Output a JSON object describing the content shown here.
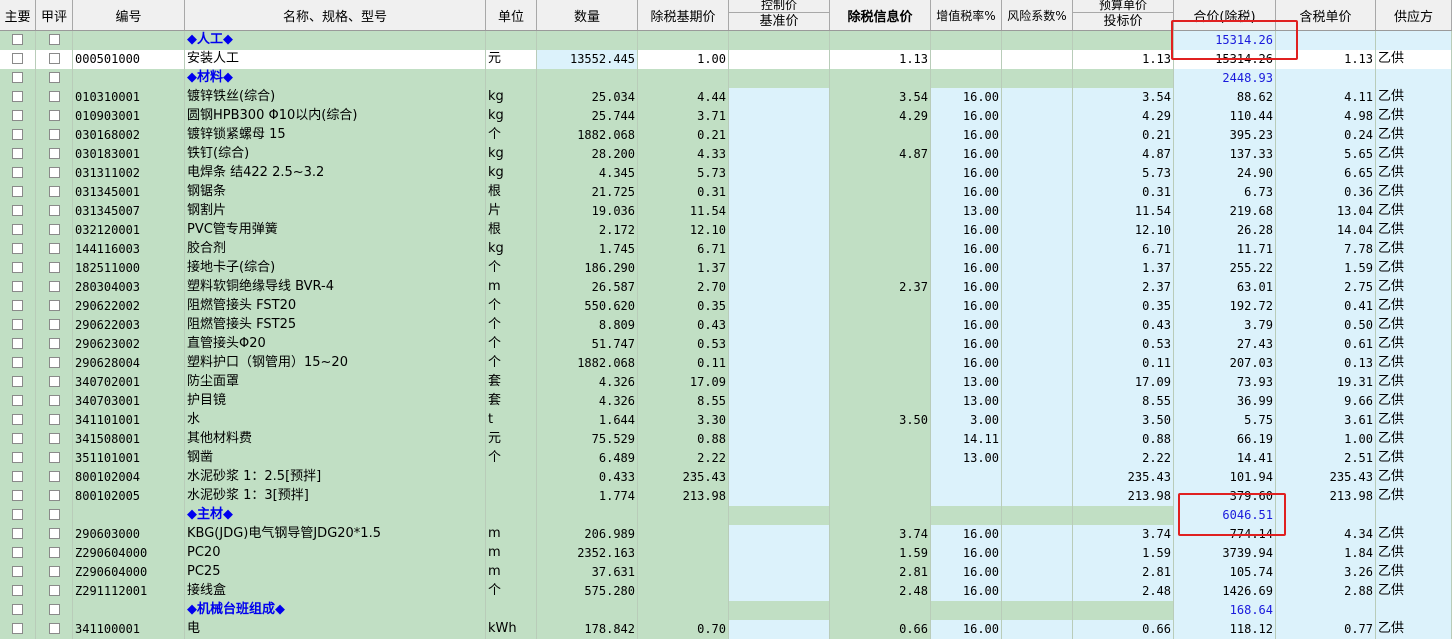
{
  "headers": {
    "zhuyao": "主要",
    "jiaping": "甲评",
    "code": "编号",
    "name": "名称、规格、型号",
    "unit": "单位",
    "qty": "数量",
    "base_price": "除税基期价",
    "ctrl_top": "控制价",
    "ctrl_bot": "基准价",
    "info_price": "除税信息价",
    "vat": "增值税率%",
    "risk": "风险系数%",
    "budget_top": "预算单价",
    "budget_bot": "投标价",
    "total": "合价(除税)",
    "tax_unit": "含税单价",
    "supplier": "供应方"
  },
  "rows": [
    {
      "type": "cat",
      "name": "◆人工◆",
      "total": "15314.26"
    },
    {
      "type": "item",
      "sel": true,
      "code": "000501000",
      "name": "安装人工",
      "unit": "元",
      "qty": "13552.445",
      "base": "1.00",
      "ctrl": "",
      "info": "1.13",
      "vat": "",
      "risk": "",
      "budget": "1.13",
      "total": "15314.26",
      "tax_unit": "1.13",
      "supplier": "乙供"
    },
    {
      "type": "cat",
      "name": "◆材料◆",
      "total": "2448.93"
    },
    {
      "type": "item",
      "code": "010310001",
      "name": "镀锌铁丝(综合)",
      "unit": "kg",
      "qty": "25.034",
      "base": "4.44",
      "ctrl": "",
      "info": "3.54",
      "vat": "16.00",
      "risk": "",
      "budget": "3.54",
      "total": "88.62",
      "tax_unit": "4.11",
      "supplier": "乙供"
    },
    {
      "type": "item",
      "code": "010903001",
      "name": "圆钢HPB300 Φ10以内(综合)",
      "unit": "kg",
      "qty": "25.744",
      "base": "3.71",
      "ctrl": "",
      "info": "4.29",
      "vat": "16.00",
      "risk": "",
      "budget": "4.29",
      "total": "110.44",
      "tax_unit": "4.98",
      "supplier": "乙供"
    },
    {
      "type": "item",
      "code": "030168002",
      "name": "镀锌锁紧螺母 15",
      "unit": "个",
      "qty": "1882.068",
      "base": "0.21",
      "ctrl": "",
      "info": "",
      "vat": "16.00",
      "risk": "",
      "budget": "0.21",
      "total": "395.23",
      "tax_unit": "0.24",
      "supplier": "乙供"
    },
    {
      "type": "item",
      "code": "030183001",
      "name": "铁钉(综合)",
      "unit": "kg",
      "qty": "28.200",
      "base": "4.33",
      "ctrl": "",
      "info": "4.87",
      "vat": "16.00",
      "risk": "",
      "budget": "4.87",
      "total": "137.33",
      "tax_unit": "5.65",
      "supplier": "乙供"
    },
    {
      "type": "item",
      "code": "031311002",
      "name": "电焊条 结422  2.5~3.2",
      "unit": "kg",
      "qty": "4.345",
      "base": "5.73",
      "ctrl": "",
      "info": "",
      "vat": "16.00",
      "risk": "",
      "budget": "5.73",
      "total": "24.90",
      "tax_unit": "6.65",
      "supplier": "乙供"
    },
    {
      "type": "item",
      "code": "031345001",
      "name": "钢锯条",
      "unit": "根",
      "qty": "21.725",
      "base": "0.31",
      "ctrl": "",
      "info": "",
      "vat": "16.00",
      "risk": "",
      "budget": "0.31",
      "total": "6.73",
      "tax_unit": "0.36",
      "supplier": "乙供"
    },
    {
      "type": "item",
      "code": "031345007",
      "name": "钢割片",
      "unit": "片",
      "qty": "19.036",
      "base": "11.54",
      "ctrl": "",
      "info": "",
      "vat": "13.00",
      "risk": "",
      "budget": "11.54",
      "total": "219.68",
      "tax_unit": "13.04",
      "supplier": "乙供"
    },
    {
      "type": "item",
      "code": "032120001",
      "name": "PVC管专用弹簧",
      "unit": "根",
      "qty": "2.172",
      "base": "12.10",
      "ctrl": "",
      "info": "",
      "vat": "16.00",
      "risk": "",
      "budget": "12.10",
      "total": "26.28",
      "tax_unit": "14.04",
      "supplier": "乙供"
    },
    {
      "type": "item",
      "code": "144116003",
      "name": "胶合剂",
      "unit": "kg",
      "qty": "1.745",
      "base": "6.71",
      "ctrl": "",
      "info": "",
      "vat": "16.00",
      "risk": "",
      "budget": "6.71",
      "total": "11.71",
      "tax_unit": "7.78",
      "supplier": "乙供"
    },
    {
      "type": "item",
      "code": "182511000",
      "name": "接地卡子(综合)",
      "unit": "个",
      "qty": "186.290",
      "base": "1.37",
      "ctrl": "",
      "info": "",
      "vat": "16.00",
      "risk": "",
      "budget": "1.37",
      "total": "255.22",
      "tax_unit": "1.59",
      "supplier": "乙供"
    },
    {
      "type": "item",
      "code": "280304003",
      "name": "塑料软铜绝缘导线 BVR-4",
      "unit": "m",
      "qty": "26.587",
      "base": "2.70",
      "ctrl": "",
      "info": "2.37",
      "vat": "16.00",
      "risk": "",
      "budget": "2.37",
      "total": "63.01",
      "tax_unit": "2.75",
      "supplier": "乙供"
    },
    {
      "type": "item",
      "code": "290622002",
      "name": "阻燃管接头 FST20",
      "unit": "个",
      "qty": "550.620",
      "base": "0.35",
      "ctrl": "",
      "info": "",
      "vat": "16.00",
      "risk": "",
      "budget": "0.35",
      "total": "192.72",
      "tax_unit": "0.41",
      "supplier": "乙供"
    },
    {
      "type": "item",
      "code": "290622003",
      "name": "阻燃管接头 FST25",
      "unit": "个",
      "qty": "8.809",
      "base": "0.43",
      "ctrl": "",
      "info": "",
      "vat": "16.00",
      "risk": "",
      "budget": "0.43",
      "total": "3.79",
      "tax_unit": "0.50",
      "supplier": "乙供"
    },
    {
      "type": "item",
      "code": "290623002",
      "name": "直管接头Φ20",
      "unit": "个",
      "qty": "51.747",
      "base": "0.53",
      "ctrl": "",
      "info": "",
      "vat": "16.00",
      "risk": "",
      "budget": "0.53",
      "total": "27.43",
      "tax_unit": "0.61",
      "supplier": "乙供"
    },
    {
      "type": "item",
      "code": "290628004",
      "name": "塑料护口（钢管用）15~20",
      "unit": "个",
      "qty": "1882.068",
      "base": "0.11",
      "ctrl": "",
      "info": "",
      "vat": "16.00",
      "risk": "",
      "budget": "0.11",
      "total": "207.03",
      "tax_unit": "0.13",
      "supplier": "乙供"
    },
    {
      "type": "item",
      "code": "340702001",
      "name": "防尘面罩",
      "unit": "套",
      "qty": "4.326",
      "base": "17.09",
      "ctrl": "",
      "info": "",
      "vat": "13.00",
      "risk": "",
      "budget": "17.09",
      "total": "73.93",
      "tax_unit": "19.31",
      "supplier": "乙供"
    },
    {
      "type": "item",
      "code": "340703001",
      "name": "护目镜",
      "unit": "套",
      "qty": "4.326",
      "base": "8.55",
      "ctrl": "",
      "info": "",
      "vat": "13.00",
      "risk": "",
      "budget": "8.55",
      "total": "36.99",
      "tax_unit": "9.66",
      "supplier": "乙供"
    },
    {
      "type": "item",
      "code": "341101001",
      "name": "水",
      "unit": "t",
      "qty": "1.644",
      "base": "3.30",
      "ctrl": "",
      "info": "3.50",
      "vat": "3.00",
      "risk": "",
      "budget": "3.50",
      "total": "5.75",
      "tax_unit": "3.61",
      "supplier": "乙供"
    },
    {
      "type": "item",
      "code": "341508001",
      "name": "其他材料费",
      "unit": "元",
      "qty": "75.529",
      "base": "0.88",
      "ctrl": "",
      "info": "",
      "vat": "14.11",
      "risk": "",
      "budget": "0.88",
      "total": "66.19",
      "tax_unit": "1.00",
      "supplier": "乙供"
    },
    {
      "type": "item",
      "code": "351101001",
      "name": "钢凿",
      "unit": "个",
      "qty": "6.489",
      "base": "2.22",
      "ctrl": "",
      "info": "",
      "vat": "13.00",
      "risk": "",
      "budget": "2.22",
      "total": "14.41",
      "tax_unit": "2.51",
      "supplier": "乙供"
    },
    {
      "type": "item",
      "code": "800102004",
      "name": "水泥砂浆 1：2.5[预拌]",
      "unit": "",
      "qty": "0.433",
      "base": "235.43",
      "ctrl": "",
      "info": "",
      "vat": "",
      "risk": "",
      "budget": "235.43",
      "total": "101.94",
      "tax_unit": "235.43",
      "supplier": "乙供"
    },
    {
      "type": "item",
      "code": "800102005",
      "name": "水泥砂浆 1：3[预拌]",
      "unit": "",
      "qty": "1.774",
      "base": "213.98",
      "ctrl": "",
      "info": "",
      "vat": "",
      "risk": "",
      "budget": "213.98",
      "total": "379.60",
      "tax_unit": "213.98",
      "supplier": "乙供"
    },
    {
      "type": "cat",
      "name": "◆主材◆",
      "total": "6046.51"
    },
    {
      "type": "item",
      "code": "290603000",
      "name": "KBG(JDG)电气钢导管JDG20*1.5",
      "unit": "m",
      "qty": "206.989",
      "base": "",
      "ctrl": "",
      "info": "3.74",
      "vat": "16.00",
      "risk": "",
      "budget": "3.74",
      "total": "774.14",
      "tax_unit": "4.34",
      "supplier": "乙供"
    },
    {
      "type": "item",
      "code": "Z290604000",
      "name": "PC20",
      "unit": "m",
      "qty": "2352.163",
      "base": "",
      "ctrl": "",
      "info": "1.59",
      "vat": "16.00",
      "risk": "",
      "budget": "1.59",
      "total": "3739.94",
      "tax_unit": "1.84",
      "supplier": "乙供"
    },
    {
      "type": "item",
      "code": "Z290604000",
      "name": "PC25",
      "unit": "m",
      "qty": "37.631",
      "base": "",
      "ctrl": "",
      "info": "2.81",
      "vat": "16.00",
      "risk": "",
      "budget": "2.81",
      "total": "105.74",
      "tax_unit": "3.26",
      "supplier": "乙供"
    },
    {
      "type": "item",
      "code": "Z291112001",
      "name": "接线盒",
      "unit": "个",
      "qty": "575.280",
      "base": "",
      "ctrl": "",
      "info": "2.48",
      "vat": "16.00",
      "risk": "",
      "budget": "2.48",
      "total": "1426.69",
      "tax_unit": "2.88",
      "supplier": "乙供"
    },
    {
      "type": "cat",
      "name": "◆机械台班组成◆",
      "total": "168.64"
    },
    {
      "type": "item",
      "code": "341100001",
      "name": "电",
      "unit": "kWh",
      "qty": "178.842",
      "base": "0.70",
      "ctrl": "",
      "info": "0.66",
      "vat": "16.00",
      "risk": "",
      "budget": "0.66",
      "total": "118.12",
      "tax_unit": "0.77",
      "supplier": "乙供"
    }
  ]
}
